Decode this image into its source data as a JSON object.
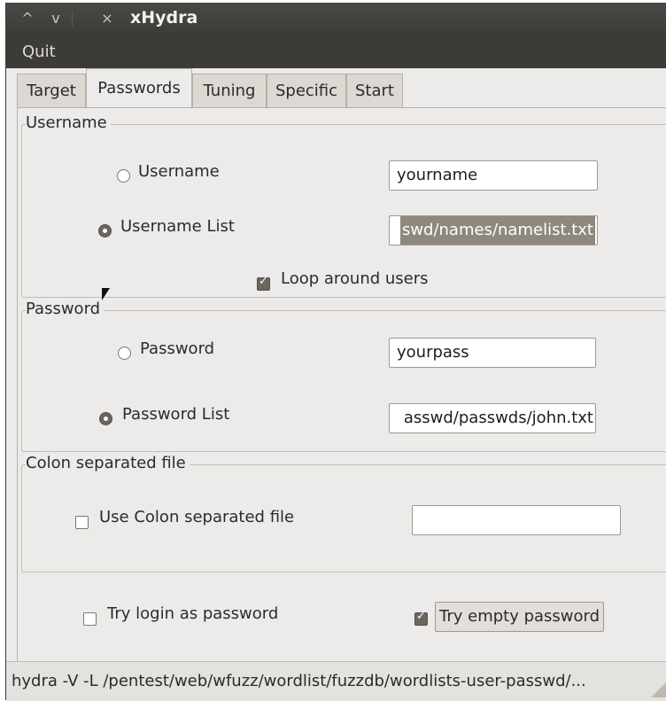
{
  "window": {
    "title": "xHydra",
    "controls": {
      "up": "^",
      "down": "v",
      "close": "×"
    }
  },
  "menubar": {
    "quit": "Quit"
  },
  "tabs": [
    {
      "label": "Target"
    },
    {
      "label": "Passwords",
      "active": true
    },
    {
      "label": "Tuning"
    },
    {
      "label": "Specific"
    },
    {
      "label": "Start"
    }
  ],
  "username_frame": {
    "title": "Username",
    "username_option": {
      "label": "Username",
      "selected": false
    },
    "username_value": "yourname",
    "list_option": {
      "label": "Username List",
      "selected": true
    },
    "list_value": "swd/names/namelist.txt",
    "loop_users": {
      "label": "Loop around users",
      "checked": true
    }
  },
  "password_frame": {
    "title": "Password",
    "password_option": {
      "label": "Password",
      "selected": false
    },
    "password_value": "yourpass",
    "list_option": {
      "label": "Password List",
      "selected": true
    },
    "list_value": "asswd/passwds/john.txt"
  },
  "colon_frame": {
    "title": "Colon separated file",
    "use_colon": {
      "label": "Use Colon separated file",
      "checked": false
    },
    "colon_value": ""
  },
  "extra_options": {
    "try_login_as_password": {
      "label": "Try login as password",
      "checked": false
    },
    "try_empty_password": {
      "label": "Try empty password",
      "checked": true
    }
  },
  "statusbar": {
    "command": "hydra -V -L /pentest/web/wfuzz/wordlist/fuzzdb/wordlists-user-passwd/..."
  }
}
